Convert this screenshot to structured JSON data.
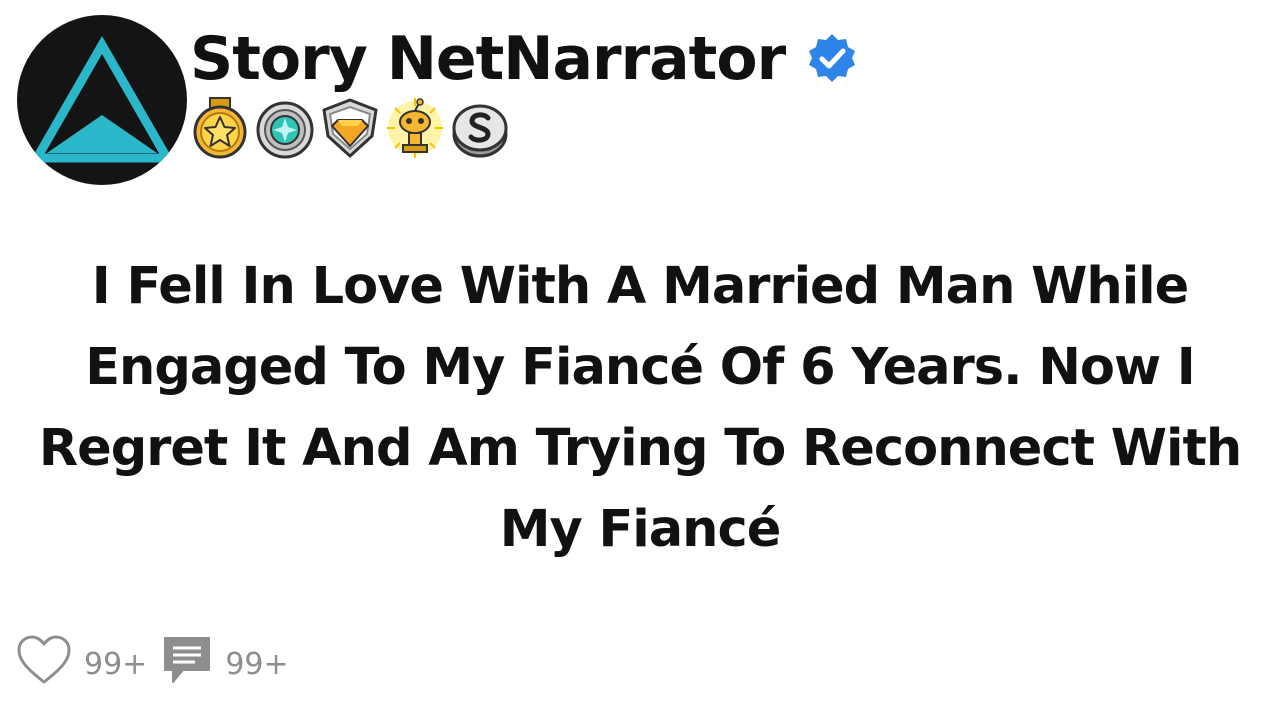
{
  "header": {
    "channel_name": "Story NetNarrator",
    "verified": true,
    "badges": [
      "star-medal-icon",
      "gem-medal-icon",
      "diamond-shield-icon",
      "trophy-alien-icon",
      "s-coin-icon"
    ]
  },
  "post": {
    "title": "I Fell In Love With A Married Man While Engaged To My Fiancé Of 6 Years. Now I Regret It And Am Trying To Reconnect With My Fiancé"
  },
  "footer": {
    "likes_count": "99+",
    "comments_count": "99+"
  },
  "colors": {
    "avatar_bg": "#141414",
    "avatar_triangle": "#2ab7c9",
    "verified_blue": "#2f84e8",
    "text": "#111111",
    "muted": "#8e8e8e"
  }
}
